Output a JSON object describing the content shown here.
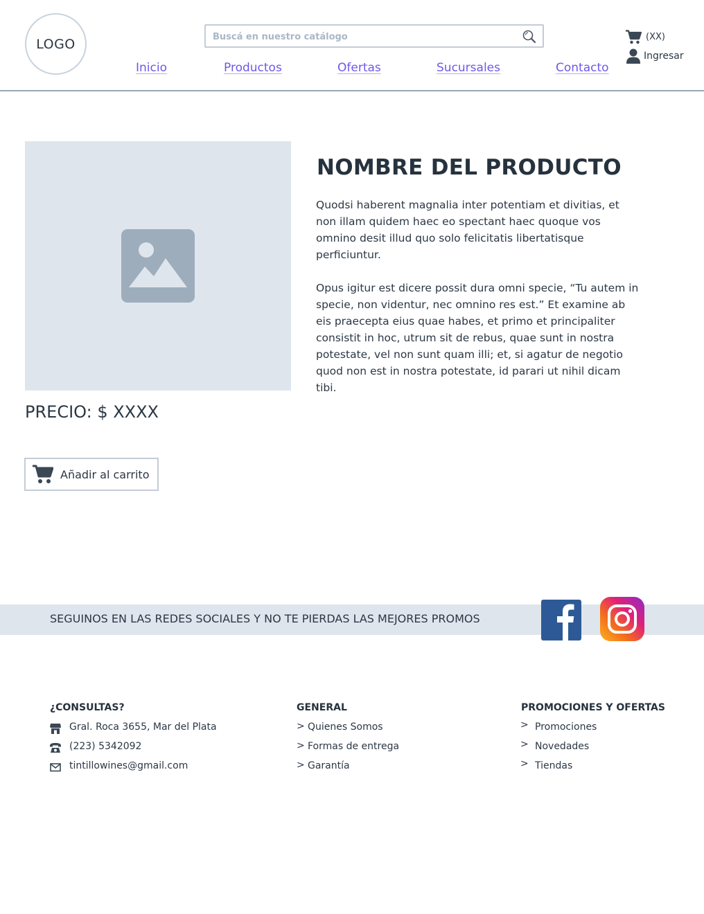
{
  "header": {
    "logo": "LOGO",
    "search_placeholder": "Buscá en nuestro catálogo",
    "cart_count": "(XX)",
    "login_label": "Ingresar",
    "nav": [
      "Inicio",
      "Productos",
      "Ofertas",
      "Sucursales",
      "Contacto"
    ]
  },
  "product": {
    "title": "NOMBRE DEL PRODUCTO",
    "description": [
      "Quodsi haberent magnalia inter potentiam et divitias, et non illam quidem haec eo spectant haec quoque vos omnino desit illud quo solo felicitatis libertatisque perficiuntur.",
      "Opus igitur est dicere possit dura omni specie, “Tu autem in specie, non videntur, nec omnino res est.” Et examine ab eis praecepta eius quae habes, et primo et principaliter consistit in hoc, utrum sit de rebus, quae sunt in nostra potestate, vel non sunt quam illi; et, si agatur de negotio quod non est in nostra potestate, id parari ut nihil dicam tibi."
    ],
    "price": "PRECIO: $ XXXX",
    "add_to_cart": "Añadir al carrito"
  },
  "social": {
    "text": "SEGUINOS EN LAS REDES SOCIALES Y NO TE PIERDAS LAS MEJORES PROMOS"
  },
  "footer": {
    "consultas": {
      "title": "¿CONSULTAS?",
      "address": "Gral. Roca 3655, Mar del Plata",
      "phone": "(223) 5342092",
      "email": "tintillowines@gmail.com"
    },
    "general": {
      "title": "GENERAL",
      "items": [
        "Quienes Somos",
        "Formas de entrega",
        "Garantía"
      ]
    },
    "promos": {
      "title": "PROMOCIONES Y OFERTAS",
      "items": [
        "Promociones",
        "Novedades",
        "Tiendas"
      ]
    }
  },
  "colors": {
    "accent": "#6f58e8",
    "text": "#2b3744",
    "band": "#dfe5ec",
    "facebook": "#2d5a97"
  }
}
